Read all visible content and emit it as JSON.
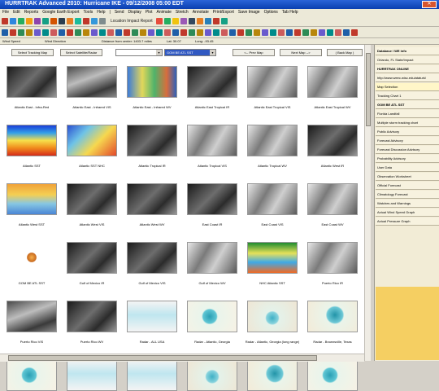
{
  "window": {
    "title": "HURRTRAK Advanced 2010: Hurricane IKE - 09/12/2008 05:00 EDT"
  },
  "menu": [
    "File",
    "Edit",
    "Reports",
    "Google Earth Export",
    "Tools",
    "Help",
    "|",
    "Send",
    "Display",
    "Plot",
    "Animate",
    "Stretch",
    "Annotate",
    "Print/Export",
    "Save Image",
    "Options",
    "Tab Help"
  ],
  "toolbar1": {
    "location_label": "Location Impact Report"
  },
  "status": {
    "field1": "Wind Speed",
    "field2": "Wind Direction",
    "field3": "Distance from center: 1403.7 miles",
    "lat": "Lat: 30.07",
    "long": "Long: -93.45"
  },
  "nav": {
    "select_tracking_map": "Select Tracking Map",
    "select_satellite_radar": "Select Satellite/Radar",
    "prev_map": "<-- Prev Map",
    "next_map": "Next Map -->",
    "back_map": "( Back Map )",
    "dropdown2_value": "GOM BE ATL SST"
  },
  "thumbnails": [
    {
      "label": "Atlantic East - Infra-Red",
      "img": "ir-dark"
    },
    {
      "label": "Atlantic East - Infrared VIS",
      "img": "ir-mid"
    },
    {
      "label": "Atlantic East - Infrared WV",
      "img": "wv-color"
    },
    {
      "label": "Atlantic East Tropical IR",
      "img": "ir-dark"
    },
    {
      "label": "Atlantic East Tropical VIS",
      "img": "vis-gray"
    },
    {
      "label": "Atlantic East Tropical WV",
      "img": "vis-gray"
    },
    {
      "label": "Atlantic SST",
      "img": "sst"
    },
    {
      "label": "Atlantic SST NHC",
      "img": "sst2"
    },
    {
      "label": "Atlantic Tropical IR",
      "img": "ir-dark"
    },
    {
      "label": "Atlantic Tropical VIS",
      "img": "vis-gray"
    },
    {
      "label": "Atlantic Tropical WV",
      "img": "vis-gray"
    },
    {
      "label": "Atlantic West IR",
      "img": "ir-dark"
    },
    {
      "label": "Atlantic West SST",
      "img": "sst3"
    },
    {
      "label": "Atlantic West VIS",
      "img": "ir-dark"
    },
    {
      "label": "Atlantic West WV",
      "img": "ir-dark"
    },
    {
      "label": "East Coast IR",
      "img": "ir-dark"
    },
    {
      "label": "East Coast VIS",
      "img": "vis-gray"
    },
    {
      "label": "East Coast WV",
      "img": "vis-gray"
    },
    {
      "label": "GOM BE ATL SST",
      "img": "folder"
    },
    {
      "label": "Gulf of Mexico IR",
      "img": "ir-dark"
    },
    {
      "label": "Gulf of Mexico VIS",
      "img": "ir-dark"
    },
    {
      "label": "Gulf of Mexico WV",
      "img": "vis-gray"
    },
    {
      "label": "NHC Atlantic SST",
      "img": "sst4"
    },
    {
      "label": "Puerto Rico IR",
      "img": "vis-gray"
    },
    {
      "label": "Puerto Rico VIS",
      "img": "ir-mid"
    },
    {
      "label": "Puerto Rico WV",
      "img": "ir-dark"
    },
    {
      "label": "Radar - ALL USA",
      "img": "radar-usa"
    },
    {
      "label": "Radar - Atlantic, Georgia",
      "img": "radar1"
    },
    {
      "label": "Radar - Atlantic, Georgia (long range)",
      "img": "radar2"
    },
    {
      "label": "Radar - Brownsville, Texas",
      "img": "radar3"
    },
    {
      "label": "",
      "img": "radar1"
    },
    {
      "label": "",
      "img": "radar-usa"
    },
    {
      "label": "",
      "img": "radar-usa"
    },
    {
      "label": "",
      "img": "radar2"
    },
    {
      "label": "",
      "img": "radar3"
    },
    {
      "label": "",
      "img": "radar1"
    }
  ],
  "right_panel": [
    {
      "label": "Database / WE info",
      "style": "hdr"
    },
    {
      "label": "Orlando, FL State/Impact",
      "style": ""
    },
    {
      "label": "HURRTRAK ONLINE",
      "style": "hdr"
    },
    {
      "label": "http://www.weec.wisc.edu/ataturk/",
      "style": ""
    },
    {
      "label": "Map Selection",
      "style": "hl"
    },
    {
      "label": "Tracking Chart 1",
      "style": ""
    },
    {
      "label": "GOM BE ATL SST",
      "style": "hdr"
    },
    {
      "label": "Florida Landfall",
      "style": ""
    },
    {
      "label": "Multiple storm tracking chart",
      "style": ""
    },
    {
      "label": "Public Advisory",
      "style": ""
    },
    {
      "label": "Forecast Advisory",
      "style": ""
    },
    {
      "label": "Forecast Discussion Advisory",
      "style": ""
    },
    {
      "label": "Probability Advisory",
      "style": ""
    },
    {
      "label": "User Data",
      "style": ""
    },
    {
      "label": "Observation Worksheet",
      "style": ""
    },
    {
      "label": "Official Forecast",
      "style": ""
    },
    {
      "label": "Climatology Forecast",
      "style": ""
    },
    {
      "label": "Watches and Warnings",
      "style": ""
    },
    {
      "label": "Actual Wind Speed Graph",
      "style": ""
    },
    {
      "label": "Actual Pressure Graph",
      "style": ""
    }
  ]
}
